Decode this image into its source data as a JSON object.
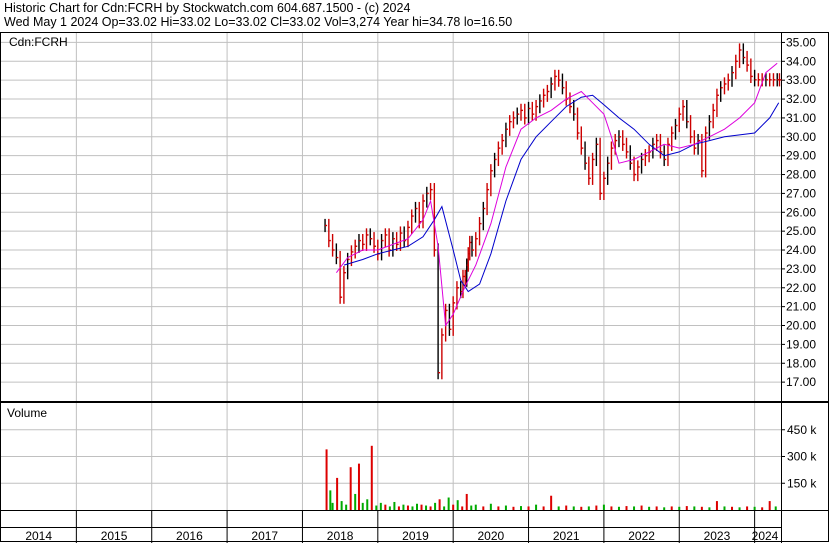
{
  "header": {
    "line1": "Historic Chart for Cdn:FCRH by Stockwatch.com 604.687.1500 - (c) 2024",
    "line2": "Wed May  1 2024   Op=33.02   Hi=33.02   Lo=33.02   Cl=33.02   Vol=3,274   Year hi=34.78   lo=16.50"
  },
  "colors": {
    "ohlc": "#cc0000",
    "ohlc_dark": "#000000",
    "ma_short": "#dd00dd",
    "ma_long": "#0000cc",
    "vol_up": "#00aa00",
    "vol_down": "#dd0000",
    "grid": "#c0c0c0",
    "frame": "#000000"
  },
  "chart_data": [
    {
      "type": "line",
      "label": "Cdn:FCRH",
      "grid": true,
      "ylim": [
        16,
        35.5
      ],
      "xlim": [
        2014.0,
        2024.35
      ],
      "yticks": [
        "35.00",
        "34.00",
        "33.00",
        "32.00",
        "31.00",
        "30.00",
        "29.00",
        "28.00",
        "27.00",
        "26.00",
        "25.00",
        "24.00",
        "23.00",
        "22.00",
        "21.00",
        "20.00",
        "19.00",
        "18.00",
        "17.00"
      ],
      "series": [
        {
          "type": "price",
          "x": [
            2018.3,
            2018.35,
            2018.4,
            2018.45,
            2018.5,
            2018.55,
            2018.6,
            2018.65,
            2018.7,
            2018.75,
            2018.8,
            2018.85,
            2018.9,
            2018.95,
            2019.0,
            2019.05,
            2019.1,
            2019.15,
            2019.2,
            2019.25,
            2019.3,
            2019.35,
            2019.4,
            2019.45,
            2019.5,
            2019.55,
            2019.6,
            2019.65,
            2019.7,
            2019.75,
            2019.8,
            2019.85,
            2019.9,
            2019.95,
            2020.0,
            2020.05,
            2020.1,
            2020.13,
            2020.16,
            2020.18,
            2020.2,
            2020.22,
            2020.25,
            2020.3,
            2020.35,
            2020.4,
            2020.45,
            2020.5,
            2020.55,
            2020.6,
            2020.65,
            2020.7,
            2020.75,
            2020.8,
            2020.85,
            2020.9,
            2020.95,
            2021.0,
            2021.05,
            2021.1,
            2021.15,
            2021.2,
            2021.25,
            2021.3,
            2021.35,
            2021.4,
            2021.45,
            2021.5,
            2021.55,
            2021.6,
            2021.65,
            2021.7,
            2021.75,
            2021.8,
            2021.85,
            2021.9,
            2021.95,
            2022.0,
            2022.05,
            2022.1,
            2022.15,
            2022.2,
            2022.25,
            2022.3,
            2022.35,
            2022.4,
            2022.45,
            2022.5,
            2022.55,
            2022.6,
            2022.65,
            2022.7,
            2022.75,
            2022.8,
            2022.85,
            2022.9,
            2022.95,
            2023.0,
            2023.05,
            2023.1,
            2023.15,
            2023.2,
            2023.25,
            2023.3,
            2023.35,
            2023.4,
            2023.45,
            2023.5,
            2023.55,
            2023.6,
            2023.65,
            2023.7,
            2023.75,
            2023.8,
            2023.85,
            2023.9,
            2023.95,
            2024.0,
            2024.05,
            2024.1,
            2024.15,
            2024.2,
            2024.25,
            2024.3,
            2024.33
          ],
          "y": [
            25.3,
            24.5,
            24.0,
            23.6,
            21.5,
            22.8,
            23.5,
            23.9,
            24.2,
            24.5,
            24.3,
            24.8,
            24.6,
            24.2,
            23.8,
            24.5,
            24.8,
            24.0,
            24.6,
            24.3,
            24.9,
            24.5,
            25.2,
            25.8,
            26.2,
            25.5,
            26.6,
            27.0,
            27.2,
            24.0,
            17.5,
            19.5,
            20.8,
            19.8,
            21.2,
            22.0,
            21.8,
            22.6,
            22.4,
            23.2,
            23.8,
            24.4,
            24.0,
            24.6,
            25.4,
            26.2,
            27.2,
            28.2,
            28.8,
            29.4,
            29.8,
            30.4,
            30.8,
            31.0,
            31.2,
            31.4,
            31.0,
            31.5,
            31.2,
            31.6,
            31.9,
            32.2,
            32.4,
            32.8,
            33.2,
            33.0,
            32.6,
            32.0,
            31.6,
            31.2,
            30.2,
            29.4,
            28.6,
            27.8,
            28.8,
            29.6,
            27.0,
            27.8,
            28.6,
            29.4,
            29.8,
            30.0,
            29.6,
            29.2,
            28.6,
            28.0,
            28.4,
            28.8,
            29.0,
            29.2,
            29.6,
            29.8,
            29.2,
            28.8,
            29.6,
            30.2,
            30.6,
            31.2,
            31.6,
            30.8,
            30.0,
            29.4,
            29.8,
            28.2,
            30.2,
            30.8,
            31.4,
            32.2,
            32.6,
            32.8,
            33.0,
            33.4,
            34.0,
            34.6,
            34.2,
            33.8,
            33.2,
            33.02,
            33.02,
            33.02,
            33.02,
            33.02,
            33.02,
            33.02,
            33.02
          ]
        },
        {
          "name": "",
          "type": "ma_short",
          "x": [
            2018.45,
            2018.6,
            2018.8,
            2019.0,
            2019.2,
            2019.4,
            2019.6,
            2019.7,
            2019.8,
            2019.9,
            2020.0,
            2020.15,
            2020.3,
            2020.5,
            2020.7,
            2020.9,
            2021.1,
            2021.3,
            2021.5,
            2021.7,
            2021.85,
            2022.0,
            2022.1,
            2022.2,
            2022.4,
            2022.6,
            2022.8,
            2023.0,
            2023.2,
            2023.4,
            2023.6,
            2023.8,
            2024.0,
            2024.15,
            2024.3
          ],
          "y": [
            22.8,
            23.6,
            24.0,
            24.0,
            24.3,
            24.6,
            25.6,
            26.6,
            24.2,
            20.0,
            20.6,
            22.0,
            23.2,
            25.4,
            28.4,
            30.4,
            31.0,
            31.4,
            32.0,
            32.4,
            31.8,
            31.2,
            30.0,
            28.6,
            28.8,
            29.2,
            29.6,
            29.4,
            29.6,
            30.0,
            30.4,
            31.0,
            31.8,
            33.4,
            33.9
          ]
        },
        {
          "name": "",
          "type": "ma_long",
          "x": [
            2018.55,
            2018.8,
            2019.0,
            2019.2,
            2019.4,
            2019.6,
            2019.75,
            2019.85,
            2020.0,
            2020.1,
            2020.2,
            2020.35,
            2020.5,
            2020.7,
            2020.9,
            2021.1,
            2021.3,
            2021.5,
            2021.7,
            2021.85,
            2022.0,
            2022.2,
            2022.4,
            2022.6,
            2022.8,
            2023.0,
            2023.2,
            2023.4,
            2023.6,
            2023.8,
            2024.0,
            2024.2,
            2024.32
          ],
          "y": [
            23.2,
            23.5,
            23.8,
            24.0,
            24.2,
            24.7,
            25.6,
            26.3,
            24.0,
            22.4,
            21.8,
            22.2,
            23.8,
            26.6,
            28.8,
            30.0,
            30.8,
            31.6,
            32.1,
            32.2,
            31.7,
            31.0,
            30.4,
            29.6,
            29.0,
            29.2,
            29.6,
            29.8,
            30.0,
            30.1,
            30.2,
            31.0,
            31.8
          ]
        }
      ]
    },
    {
      "type": "bar",
      "label": "Volume",
      "grid": true,
      "ylim": [
        0,
        600
      ],
      "yticks": [
        "450 k",
        "300 k",
        "150 k"
      ],
      "series": [
        {
          "name": "",
          "x": [
            2018.32,
            2018.37,
            2018.4,
            2018.46,
            2018.52,
            2018.58,
            2018.64,
            2018.7,
            2018.75,
            2018.8,
            2018.86,
            2018.92,
            2018.98,
            2019.04,
            2019.1,
            2019.16,
            2019.22,
            2019.28,
            2019.34,
            2019.4,
            2019.46,
            2019.52,
            2019.58,
            2019.64,
            2019.7,
            2019.76,
            2019.82,
            2019.88,
            2019.94,
            2020.0,
            2020.06,
            2020.12,
            2020.18,
            2020.24,
            2020.3,
            2020.4,
            2020.5,
            2020.6,
            2020.7,
            2020.8,
            2020.9,
            2021.0,
            2021.1,
            2021.2,
            2021.3,
            2021.4,
            2021.5,
            2021.6,
            2021.7,
            2021.8,
            2021.9,
            2022.0,
            2022.1,
            2022.2,
            2022.3,
            2022.4,
            2022.5,
            2022.6,
            2022.7,
            2022.8,
            2022.9,
            2023.0,
            2023.1,
            2023.2,
            2023.3,
            2023.4,
            2023.5,
            2023.6,
            2023.7,
            2023.8,
            2023.9,
            2024.0,
            2024.1,
            2024.2,
            2024.28
          ],
          "values": [
            340,
            110,
            40,
            180,
            50,
            30,
            240,
            90,
            260,
            40,
            60,
            360,
            25,
            40,
            30,
            20,
            45,
            20,
            30,
            25,
            20,
            35,
            30,
            25,
            20,
            40,
            60,
            20,
            70,
            30,
            55,
            20,
            90,
            25,
            30,
            20,
            35,
            20,
            25,
            18,
            22,
            20,
            30,
            20,
            80,
            20,
            25,
            20,
            18,
            20,
            25,
            30,
            20,
            18,
            22,
            20,
            25,
            18,
            20,
            15,
            20,
            18,
            22,
            20,
            18,
            15,
            50,
            20,
            18,
            15,
            20,
            18,
            15,
            50,
            20
          ],
          "up": [
            false,
            true,
            true,
            false,
            true,
            true,
            false,
            true,
            false,
            true,
            true,
            false,
            true,
            true,
            false,
            true,
            true,
            false,
            true,
            false,
            true,
            true,
            false,
            true,
            false,
            true,
            false,
            true,
            true,
            false,
            true,
            false,
            false,
            true,
            true,
            false,
            true,
            false,
            true,
            false,
            true,
            false,
            true,
            false,
            false,
            true,
            false,
            true,
            false,
            true,
            false,
            true,
            false,
            true,
            false,
            true,
            false,
            true,
            false,
            true,
            false,
            true,
            false,
            true,
            false,
            true,
            false,
            true,
            false,
            true,
            false,
            true,
            false,
            false,
            true
          ]
        }
      ]
    }
  ],
  "xaxis": {
    "years": [
      "2014",
      "2015",
      "2016",
      "2017",
      "2018",
      "2019",
      "2020",
      "2021",
      "2022",
      "2023",
      "2024"
    ]
  }
}
